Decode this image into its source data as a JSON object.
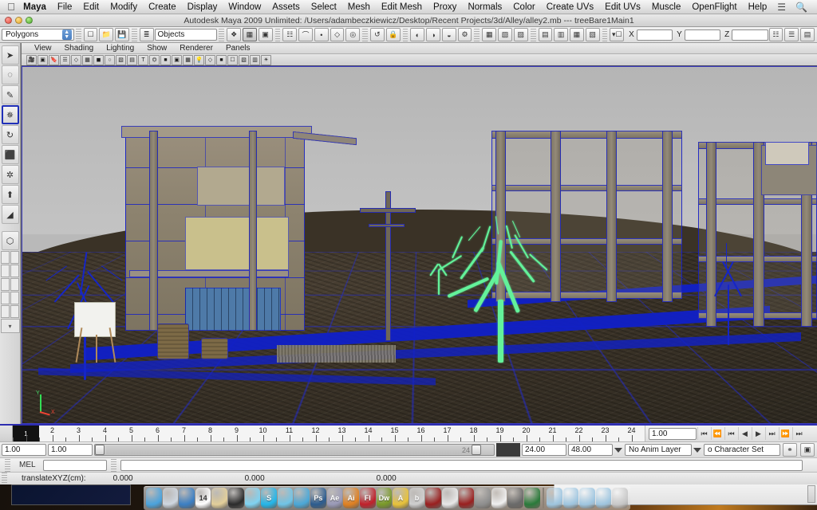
{
  "os_menu": {
    "apple_icon": "apple-icon",
    "items": [
      {
        "label": "Maya",
        "bold": true
      },
      {
        "label": "File",
        "bold": false
      },
      {
        "label": "Edit",
        "bold": false
      },
      {
        "label": "Modify",
        "bold": false
      },
      {
        "label": "Create",
        "bold": false
      },
      {
        "label": "Display",
        "bold": false
      },
      {
        "label": "Window",
        "bold": false
      },
      {
        "label": "Assets",
        "bold": false
      },
      {
        "label": "Select",
        "bold": false
      },
      {
        "label": "Mesh",
        "bold": false
      },
      {
        "label": "Edit Mesh",
        "bold": false
      },
      {
        "label": "Proxy",
        "bold": false
      },
      {
        "label": "Normals",
        "bold": false
      },
      {
        "label": "Color",
        "bold": false
      },
      {
        "label": "Create UVs",
        "bold": false
      },
      {
        "label": "Edit UVs",
        "bold": false
      },
      {
        "label": "Muscle",
        "bold": false
      },
      {
        "label": "OpenFlight",
        "bold": false
      },
      {
        "label": "Help",
        "bold": false
      }
    ],
    "right_icons": [
      "input-menu-icon",
      "spotlight-search-icon"
    ]
  },
  "title_bar": {
    "title": "Autodesk Maya 2009 Unlimited: /Users/adambeczkiewicz/Desktop/Recent Projects/3d/Alley/alley2.mb   ---   treeBare1Main1",
    "close_label": "close-button",
    "minimize_label": "minimize-button",
    "zoom_label": "zoom-button"
  },
  "status_line": {
    "menuset_value": "Polygons",
    "selection_mask_value": "Objects",
    "x_label": "X",
    "y_label": "Y",
    "z_label": "Z",
    "x_value": "",
    "y_value": "",
    "z_value": "",
    "buttons": [
      {
        "name": "new-scene-icon",
        "glyph": "□"
      },
      {
        "name": "open-scene-icon",
        "glyph": "▰"
      },
      {
        "name": "save-scene-icon",
        "glyph": "▤"
      },
      {
        "name": "selection-mode-hierarchy-icon",
        "glyph": "≡"
      },
      {
        "name": "select-by-object-type-icon",
        "glyph": "❖"
      },
      {
        "name": "select-by-component-type-icon",
        "glyph": "⬟"
      },
      {
        "name": "select-by-render-type-icon",
        "glyph": "▣"
      },
      {
        "name": "snap-to-grid-icon",
        "glyph": "⋆"
      },
      {
        "name": "snap-to-curve-icon",
        "glyph": "⌒"
      },
      {
        "name": "snap-to-point-icon",
        "glyph": "•"
      },
      {
        "name": "snap-to-view-plane-icon",
        "glyph": "◇"
      },
      {
        "name": "construction-history-icon",
        "glyph": "↺"
      },
      {
        "name": "render-view-icon",
        "glyph": "◐"
      },
      {
        "name": "render-current-frame-icon",
        "glyph": "◑"
      },
      {
        "name": "ipr-render-icon",
        "glyph": "◒"
      },
      {
        "name": "render-settings-icon",
        "glyph": "⚙"
      },
      {
        "name": "show-hide-editors-icon",
        "glyph": "▾"
      }
    ],
    "right_buttons": [
      {
        "name": "attribute-editor-toggle-icon",
        "glyph": "☷"
      },
      {
        "name": "tool-settings-toggle-icon",
        "glyph": "☲"
      },
      {
        "name": "channel-box-toggle-icon",
        "glyph": "☰"
      }
    ]
  },
  "toolbox": {
    "tools": [
      {
        "name": "select-tool",
        "glyph": "➤",
        "selected": false
      },
      {
        "name": "lasso-select-tool",
        "glyph": "◌",
        "selected": false
      },
      {
        "name": "paint-select-tool",
        "glyph": "✎",
        "selected": false
      },
      {
        "name": "move-tool",
        "glyph": "✥",
        "selected": true
      },
      {
        "name": "rotate-tool",
        "glyph": "↻",
        "selected": false
      },
      {
        "name": "scale-tool",
        "glyph": "⬛",
        "selected": false
      },
      {
        "name": "universal-manipulator-tool",
        "glyph": "✲",
        "selected": false
      },
      {
        "name": "soft-modification-tool",
        "glyph": "⬆",
        "selected": false
      },
      {
        "name": "show-manipulator-tool",
        "glyph": "◢",
        "selected": false
      }
    ],
    "last_tool": {
      "name": "last-tool-used-icon",
      "glyph": "⬡"
    },
    "layouts": [
      {
        "name": "layout-single-perspective-icon"
      },
      {
        "name": "layout-four-view-icon"
      },
      {
        "name": "layout-outliner-persp-icon"
      },
      {
        "name": "layout-persp-graph-icon"
      },
      {
        "name": "layout-hypershade-persp-icon"
      },
      {
        "name": "layout-persp-render-icon"
      }
    ]
  },
  "panel": {
    "menus": [
      "View",
      "Shading",
      "Lighting",
      "Show",
      "Renderer",
      "Panels"
    ],
    "shelf_icons": [
      "select-camera-icon",
      "camera-attributes-icon",
      "bookmarks-icon",
      "image-plane-icon",
      "two-d-pan-zoom-icon",
      "grid-toggle-icon",
      "film-gate-icon",
      "resolution-gate-icon",
      "gate-mask-icon",
      "field-chart-icon",
      "safe-action-icon",
      "safe-title-icon",
      "wireframe-icon",
      "smooth-shade-all-icon",
      "smooth-shade-selected-icon",
      "flat-shade-icon",
      "wireframe-on-shaded-icon",
      "textured-icon",
      "use-all-lights-icon",
      "shadows-icon",
      "isolate-select-icon",
      "xray-icon",
      "xray-joints-icon",
      "exposure-icon"
    ],
    "axis": {
      "x_label": "X",
      "y_label": "Y"
    }
  },
  "viewport": {
    "selected_object": "treeBare1Main1",
    "selection_color": "#63f29a",
    "wireframe_color": "#1525c8",
    "ground_color": "#3b3328",
    "sky_color": "#bdbdbd"
  },
  "time_slider": {
    "frames": [
      1,
      2,
      3,
      4,
      5,
      6,
      7,
      8,
      9,
      10,
      11,
      12,
      13,
      14,
      15,
      16,
      17,
      18,
      19,
      20,
      21,
      22,
      23,
      24
    ],
    "current_frame": "1",
    "current_frame_field": "1.00",
    "playback_buttons": [
      {
        "name": "go-to-start-button",
        "glyph": "⏮"
      },
      {
        "name": "step-back-frame-button",
        "glyph": "⏴|"
      },
      {
        "name": "step-back-key-button",
        "glyph": "|◀"
      },
      {
        "name": "play-backwards-button",
        "glyph": "◀"
      },
      {
        "name": "play-forwards-button",
        "glyph": "▶"
      },
      {
        "name": "step-forward-key-button",
        "glyph": "▶|"
      },
      {
        "name": "step-forward-frame-button",
        "glyph": "|⏵"
      },
      {
        "name": "go-to-end-button",
        "glyph": "⏭"
      }
    ]
  },
  "range_slider": {
    "anim_start": "1.00",
    "range_start": "1.00",
    "range_end": "24.00",
    "anim_end": "48.00",
    "slider_label": "24",
    "anim_layer": "No Anim Layer",
    "character_set": "o Character Set",
    "auto_key_icon": "auto-keyframe-icon",
    "anim_prefs_icon": "animation-preferences-icon"
  },
  "mel": {
    "label": "MEL",
    "input_value": "",
    "output_value": ""
  },
  "help_line": {
    "field_label": "translateXYZ(cm):",
    "value_x": "0.000",
    "value_y": "0.000",
    "value_z": "0.000"
  },
  "dock": {
    "items": [
      {
        "name": "finder-icon",
        "label": "",
        "color": "#4aa3dd"
      },
      {
        "name": "preview-icon",
        "label": "",
        "color": "#cfd7e0"
      },
      {
        "name": "safari-icon",
        "label": "",
        "color": "#3b7fc4"
      },
      {
        "name": "ical-icon",
        "label": "14",
        "color": "#ffffff"
      },
      {
        "name": "stickies-icon",
        "label": "",
        "color": "#e3cf9a"
      },
      {
        "name": "dvd-player-icon",
        "label": "",
        "color": "#2b2b2b"
      },
      {
        "name": "itunes-icon",
        "label": "",
        "color": "#7fd3f2"
      },
      {
        "name": "skype-icon",
        "label": "S",
        "color": "#22b6ea"
      },
      {
        "name": "utility-icon",
        "label": "",
        "color": "#6fc5e8"
      },
      {
        "name": "ichat-icon",
        "label": "",
        "color": "#4aa8d8"
      },
      {
        "name": "photoshop-icon",
        "label": "Ps",
        "color": "#2c5c8f"
      },
      {
        "name": "after-effects-icon",
        "label": "Ae",
        "color": "#9a9ab8"
      },
      {
        "name": "illustrator-icon",
        "label": "Ai",
        "color": "#e08020"
      },
      {
        "name": "flash-icon",
        "label": "Fl",
        "color": "#c0202a"
      },
      {
        "name": "dreamweaver-icon",
        "label": "Dw",
        "color": "#7a9b28"
      },
      {
        "name": "autodesk-maya-icon",
        "label": "A",
        "color": "#e8c23a"
      },
      {
        "name": "soundbooth-icon",
        "label": "b",
        "color": "#cfcfcf"
      },
      {
        "name": "maya-app-icon",
        "label": "",
        "color": "#9a1f1f"
      },
      {
        "name": "poker-icon",
        "label": "",
        "color": "#e8e8e8"
      },
      {
        "name": "maya-doc-icon",
        "label": "",
        "color": "#9a1f1f"
      },
      {
        "name": "system-prefs-icon",
        "label": "",
        "color": "#8f8f8f"
      },
      {
        "name": "textedit-icon",
        "label": "",
        "color": "#f0f0f0"
      },
      {
        "name": "quicktime-icon",
        "label": "",
        "color": "#6a6a6a"
      },
      {
        "name": "cyberduck-icon",
        "label": "",
        "color": "#2a7a3a"
      },
      {
        "name": "downloads-stack-icon",
        "label": "",
        "color": "#9fc6e0"
      },
      {
        "name": "documents-stack-icon",
        "label": "",
        "color": "#9fc6e0"
      },
      {
        "name": "applications-stack-icon",
        "label": "",
        "color": "#9fc6e0"
      },
      {
        "name": "pictures-stack-icon",
        "label": "",
        "color": "#9fc6e0"
      },
      {
        "name": "trash-icon",
        "label": "",
        "color": "#c8c8c8"
      }
    ]
  }
}
